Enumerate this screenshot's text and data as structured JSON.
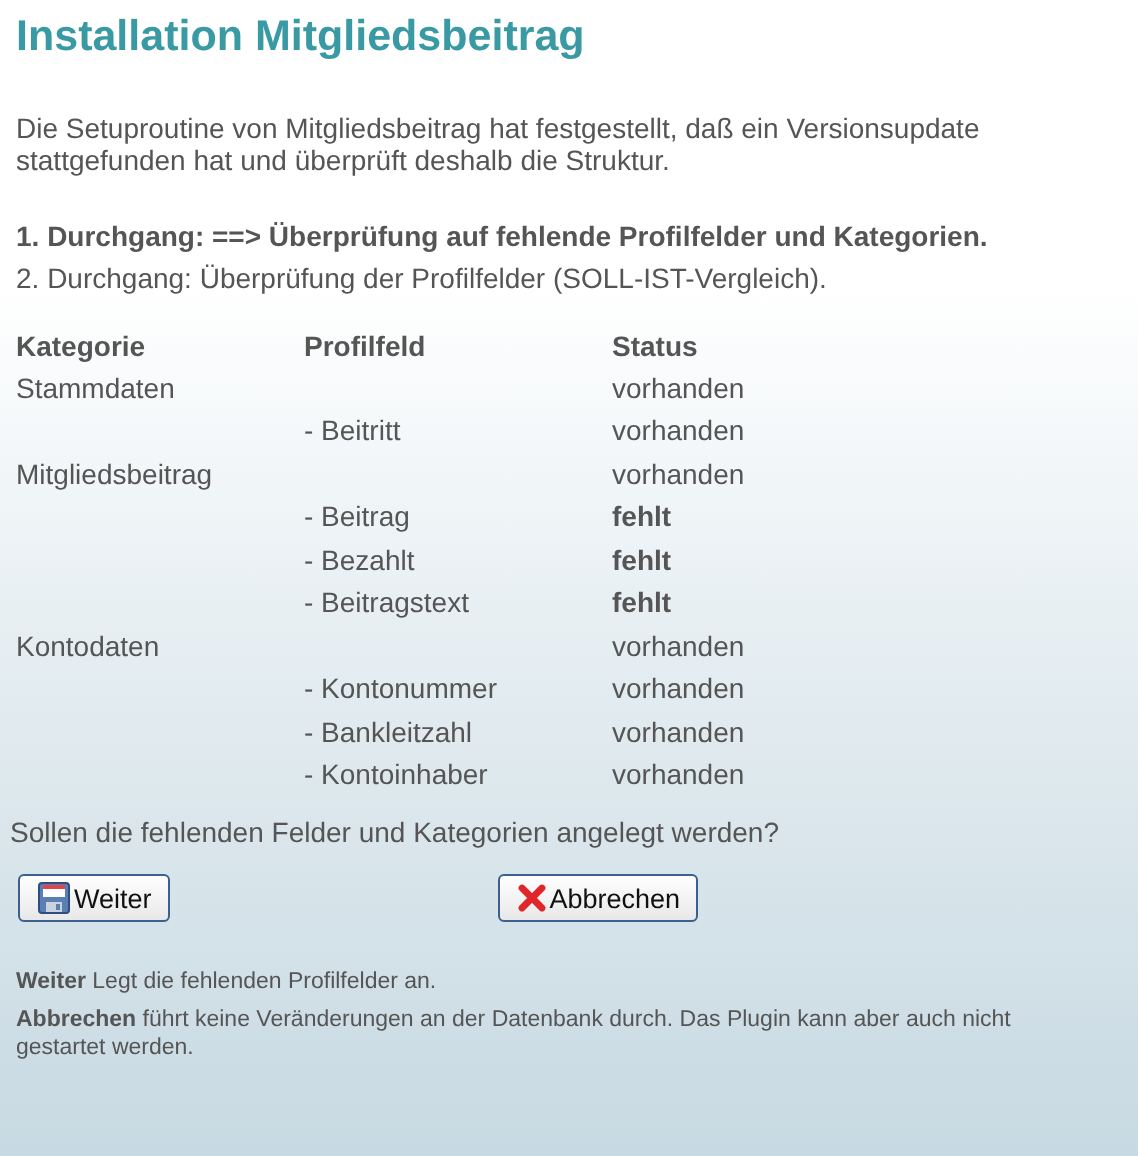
{
  "title": "Installation Mitgliedsbeitrag",
  "intro": "Die Setuproutine von Mitgliedsbeitrag hat festgestellt, daß ein Versionsupdate stattgefunden hat und überprüft deshalb die Struktur.",
  "passes": [
    {
      "text": "1. Durchgang: ==> Überprüfung auf fehlende Profilfelder und Kategorien.",
      "current": true
    },
    {
      "text": "2. Durchgang: Überprüfung der Profilfelder (SOLL-IST-Vergleich).",
      "current": false
    }
  ],
  "table": {
    "columns": [
      "Kategorie",
      "Profilfeld",
      "Status"
    ],
    "rows": [
      {
        "category": "Stammdaten",
        "status": "vorhanden",
        "missing": false
      },
      {
        "field": "- Beitritt",
        "status": "vorhanden",
        "missing": false
      },
      {
        "category": "Mitgliedsbeitrag",
        "status": "vorhanden",
        "missing": false
      },
      {
        "field": "- Beitrag",
        "status": "fehlt",
        "missing": true
      },
      {
        "field": "- Bezahlt",
        "status": "fehlt",
        "missing": true
      },
      {
        "field": "- Beitragstext",
        "status": "fehlt",
        "missing": true
      },
      {
        "category": "Kontodaten",
        "status": "vorhanden",
        "missing": false
      },
      {
        "field": "- Kontonummer",
        "status": "vorhanden",
        "missing": false
      },
      {
        "field": "- Bankleitzahl",
        "status": "vorhanden",
        "missing": false
      },
      {
        "field": "- Kontoinhaber",
        "status": "vorhanden",
        "missing": false
      }
    ]
  },
  "question": "Sollen die fehlenden Felder und Kategorien angelegt werden?",
  "buttons": [
    {
      "label": "Weiter",
      "kind": "save"
    },
    {
      "label": "Abbrechen",
      "kind": "cancel"
    }
  ],
  "notes": [
    "**Weiter** Legt die fehlenden Profilfelder an.",
    "**Abbrechen** führt keine Veränderungen an der Datenbank durch. Das Plugin kann aber auch nicht gestartet werden."
  ]
}
